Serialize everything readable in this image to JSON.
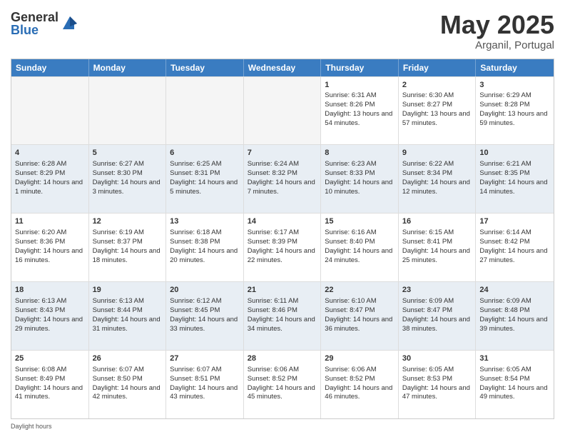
{
  "header": {
    "logo_general": "General",
    "logo_blue": "Blue",
    "month_title": "May 2025",
    "location": "Arganil, Portugal"
  },
  "weekdays": [
    "Sunday",
    "Monday",
    "Tuesday",
    "Wednesday",
    "Thursday",
    "Friday",
    "Saturday"
  ],
  "footer_text": "Daylight hours",
  "rows": [
    [
      {
        "day": "",
        "sunrise": "",
        "sunset": "",
        "daylight": "",
        "empty": true
      },
      {
        "day": "",
        "sunrise": "",
        "sunset": "",
        "daylight": "",
        "empty": true
      },
      {
        "day": "",
        "sunrise": "",
        "sunset": "",
        "daylight": "",
        "empty": true
      },
      {
        "day": "",
        "sunrise": "",
        "sunset": "",
        "daylight": "",
        "empty": true
      },
      {
        "day": "1",
        "sunrise": "Sunrise: 6:31 AM",
        "sunset": "Sunset: 8:26 PM",
        "daylight": "Daylight: 13 hours and 54 minutes."
      },
      {
        "day": "2",
        "sunrise": "Sunrise: 6:30 AM",
        "sunset": "Sunset: 8:27 PM",
        "daylight": "Daylight: 13 hours and 57 minutes."
      },
      {
        "day": "3",
        "sunrise": "Sunrise: 6:29 AM",
        "sunset": "Sunset: 8:28 PM",
        "daylight": "Daylight: 13 hours and 59 minutes."
      }
    ],
    [
      {
        "day": "4",
        "sunrise": "Sunrise: 6:28 AM",
        "sunset": "Sunset: 8:29 PM",
        "daylight": "Daylight: 14 hours and 1 minute."
      },
      {
        "day": "5",
        "sunrise": "Sunrise: 6:27 AM",
        "sunset": "Sunset: 8:30 PM",
        "daylight": "Daylight: 14 hours and 3 minutes."
      },
      {
        "day": "6",
        "sunrise": "Sunrise: 6:25 AM",
        "sunset": "Sunset: 8:31 PM",
        "daylight": "Daylight: 14 hours and 5 minutes."
      },
      {
        "day": "7",
        "sunrise": "Sunrise: 6:24 AM",
        "sunset": "Sunset: 8:32 PM",
        "daylight": "Daylight: 14 hours and 7 minutes."
      },
      {
        "day": "8",
        "sunrise": "Sunrise: 6:23 AM",
        "sunset": "Sunset: 8:33 PM",
        "daylight": "Daylight: 14 hours and 10 minutes."
      },
      {
        "day": "9",
        "sunrise": "Sunrise: 6:22 AM",
        "sunset": "Sunset: 8:34 PM",
        "daylight": "Daylight: 14 hours and 12 minutes."
      },
      {
        "day": "10",
        "sunrise": "Sunrise: 6:21 AM",
        "sunset": "Sunset: 8:35 PM",
        "daylight": "Daylight: 14 hours and 14 minutes."
      }
    ],
    [
      {
        "day": "11",
        "sunrise": "Sunrise: 6:20 AM",
        "sunset": "Sunset: 8:36 PM",
        "daylight": "Daylight: 14 hours and 16 minutes."
      },
      {
        "day": "12",
        "sunrise": "Sunrise: 6:19 AM",
        "sunset": "Sunset: 8:37 PM",
        "daylight": "Daylight: 14 hours and 18 minutes."
      },
      {
        "day": "13",
        "sunrise": "Sunrise: 6:18 AM",
        "sunset": "Sunset: 8:38 PM",
        "daylight": "Daylight: 14 hours and 20 minutes."
      },
      {
        "day": "14",
        "sunrise": "Sunrise: 6:17 AM",
        "sunset": "Sunset: 8:39 PM",
        "daylight": "Daylight: 14 hours and 22 minutes."
      },
      {
        "day": "15",
        "sunrise": "Sunrise: 6:16 AM",
        "sunset": "Sunset: 8:40 PM",
        "daylight": "Daylight: 14 hours and 24 minutes."
      },
      {
        "day": "16",
        "sunrise": "Sunrise: 6:15 AM",
        "sunset": "Sunset: 8:41 PM",
        "daylight": "Daylight: 14 hours and 25 minutes."
      },
      {
        "day": "17",
        "sunrise": "Sunrise: 6:14 AM",
        "sunset": "Sunset: 8:42 PM",
        "daylight": "Daylight: 14 hours and 27 minutes."
      }
    ],
    [
      {
        "day": "18",
        "sunrise": "Sunrise: 6:13 AM",
        "sunset": "Sunset: 8:43 PM",
        "daylight": "Daylight: 14 hours and 29 minutes."
      },
      {
        "day": "19",
        "sunrise": "Sunrise: 6:13 AM",
        "sunset": "Sunset: 8:44 PM",
        "daylight": "Daylight: 14 hours and 31 minutes."
      },
      {
        "day": "20",
        "sunrise": "Sunrise: 6:12 AM",
        "sunset": "Sunset: 8:45 PM",
        "daylight": "Daylight: 14 hours and 33 minutes."
      },
      {
        "day": "21",
        "sunrise": "Sunrise: 6:11 AM",
        "sunset": "Sunset: 8:46 PM",
        "daylight": "Daylight: 14 hours and 34 minutes."
      },
      {
        "day": "22",
        "sunrise": "Sunrise: 6:10 AM",
        "sunset": "Sunset: 8:47 PM",
        "daylight": "Daylight: 14 hours and 36 minutes."
      },
      {
        "day": "23",
        "sunrise": "Sunrise: 6:09 AM",
        "sunset": "Sunset: 8:47 PM",
        "daylight": "Daylight: 14 hours and 38 minutes."
      },
      {
        "day": "24",
        "sunrise": "Sunrise: 6:09 AM",
        "sunset": "Sunset: 8:48 PM",
        "daylight": "Daylight: 14 hours and 39 minutes."
      }
    ],
    [
      {
        "day": "25",
        "sunrise": "Sunrise: 6:08 AM",
        "sunset": "Sunset: 8:49 PM",
        "daylight": "Daylight: 14 hours and 41 minutes."
      },
      {
        "day": "26",
        "sunrise": "Sunrise: 6:07 AM",
        "sunset": "Sunset: 8:50 PM",
        "daylight": "Daylight: 14 hours and 42 minutes."
      },
      {
        "day": "27",
        "sunrise": "Sunrise: 6:07 AM",
        "sunset": "Sunset: 8:51 PM",
        "daylight": "Daylight: 14 hours and 43 minutes."
      },
      {
        "day": "28",
        "sunrise": "Sunrise: 6:06 AM",
        "sunset": "Sunset: 8:52 PM",
        "daylight": "Daylight: 14 hours and 45 minutes."
      },
      {
        "day": "29",
        "sunrise": "Sunrise: 6:06 AM",
        "sunset": "Sunset: 8:52 PM",
        "daylight": "Daylight: 14 hours and 46 minutes."
      },
      {
        "day": "30",
        "sunrise": "Sunrise: 6:05 AM",
        "sunset": "Sunset: 8:53 PM",
        "daylight": "Daylight: 14 hours and 47 minutes."
      },
      {
        "day": "31",
        "sunrise": "Sunrise: 6:05 AM",
        "sunset": "Sunset: 8:54 PM",
        "daylight": "Daylight: 14 hours and 49 minutes."
      }
    ]
  ]
}
